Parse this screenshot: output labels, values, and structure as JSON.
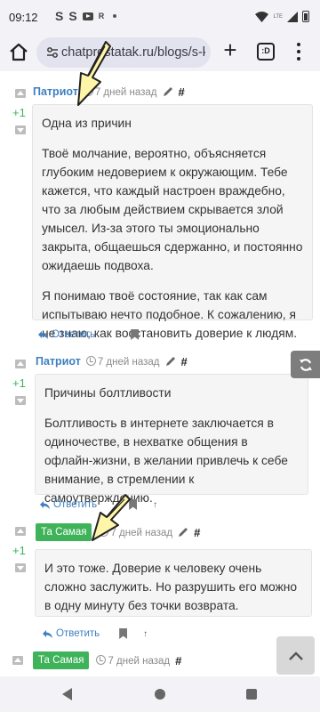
{
  "status_bar": {
    "time": "09:12",
    "notifications": [
      "S",
      "S",
      "youtube",
      "R"
    ],
    "network": "LTE"
  },
  "browser": {
    "url": "chatprostatak.ru/blogs/s-k",
    "tabs_label": ":D"
  },
  "comments": [
    {
      "author": "Патриот",
      "author_style": "link",
      "time": "7 дней назад",
      "hash": "#",
      "score": "+1",
      "paragraphs": [
        "Одна из причин",
        "Твоё молчание, вероятно, объясняется глубоким недоверием к окружающим. Тебе кажется, что каждый настроен враждебно, что за любым действием скрывается злой умысел. Из-за этого ты эмоционально закрыта, общаешься сдержанно, и постоянно ожидаешь подвоха.",
        "Я понимаю твоё состояние, так как сам испытываю нечто подобное. К сожалению, я не знаю, как восстановить доверие к людям."
      ],
      "reply_label": "Ответить"
    },
    {
      "author": "Патриот",
      "author_style": "link",
      "time": "7 дней назад",
      "hash": "#",
      "score": "+1",
      "paragraphs": [
        "Причины болтливости",
        "Болтливость в интернете заключается в одиночестве, в нехватке общения в офлайн-жизни, в желании привлечь к себе внимание, в стремлении к самоутверждению."
      ],
      "reply_label": "Ответить",
      "up_arrow": "↑"
    },
    {
      "author": "Та Самая",
      "author_style": "badge",
      "time": "7 дней назад",
      "hash": "#",
      "score": "+1",
      "paragraphs": [
        "И это тоже. Доверие к человеку очень сложно заслужить. Но разрушить его можно в одну минуту без точки возврата."
      ],
      "reply_label": "Ответить",
      "up_arrow": "↑"
    },
    {
      "author": "Та Самая",
      "author_style": "badge",
      "time": "7 дней назад",
      "hash": "#"
    }
  ],
  "colors": {
    "accent_link": "#3d7fc1",
    "score_green": "#3cb55b",
    "badge_green": "#3fb35a",
    "pointer_yellow": "#fff5a8"
  }
}
